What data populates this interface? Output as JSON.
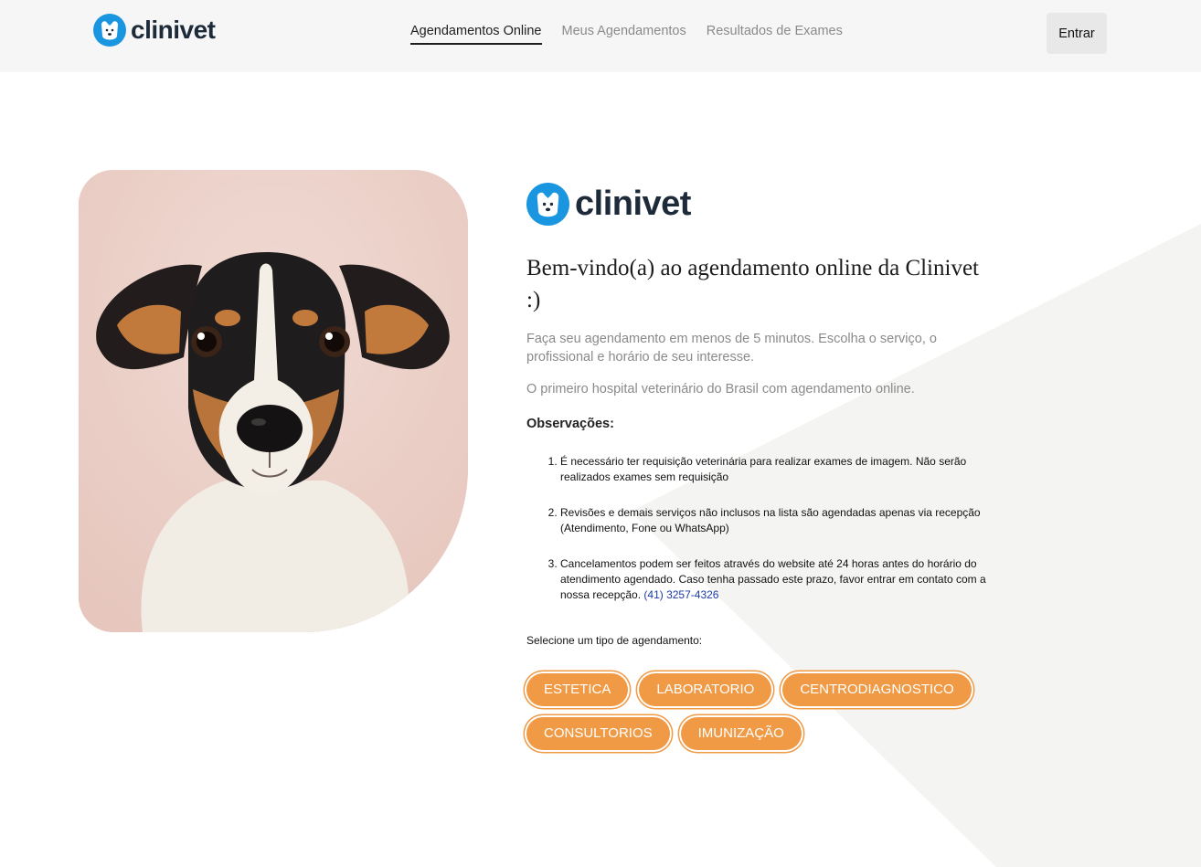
{
  "brand": {
    "name": "clinivet",
    "color": "#1a96e0"
  },
  "nav": {
    "items": [
      {
        "label": "Agendamentos Online",
        "active": true
      },
      {
        "label": "Meus Agendamentos",
        "active": false
      },
      {
        "label": "Resultados de Exames",
        "active": false
      }
    ],
    "login_label": "Entrar"
  },
  "hero": {
    "image_alt_icon": "dog-photo",
    "title": "Bem-vindo(a) ao agendamento online da Clinivet :)",
    "intro": "Faça seu agendamento em menos de 5 minutos. Escolha o serviço, o profissional e horário de seu interesse.",
    "tagline": "O primeiro hospital veterinário do Brasil com agendamento online.",
    "observations_title": "Observações:",
    "observations": [
      "É necessário ter requisição veterinária para realizar exames de imagem. Não serão realizados exames sem requisição",
      "Revisões e demais serviços não inclusos na lista são agendadas apenas via recepção (Atendimento, Fone ou WhatsApp)",
      "Cancelamentos podem ser feitos através do website até 24 horas antes do horário do atendimento agendado. Caso tenha passado este prazo, favor entrar em contato com a nossa recepção."
    ],
    "phone": "(41) 3257-4326",
    "select_label": "Selecione um tipo de agendamento:",
    "types": [
      "ESTETICA",
      "LABORATORIO",
      "CENTRODIAGNOSTICO",
      "CONSULTORIOS",
      "IMUNIZAÇÃO"
    ],
    "accent_color": "#f09a45"
  }
}
